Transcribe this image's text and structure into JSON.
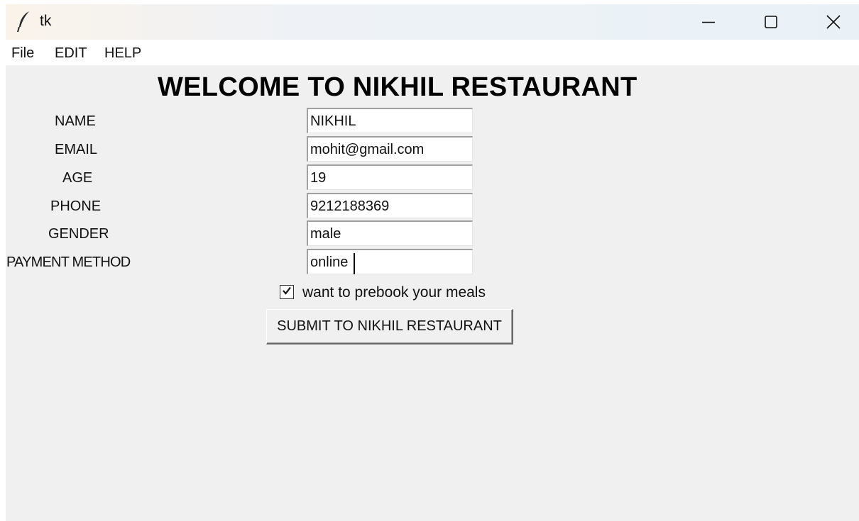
{
  "window": {
    "title": "tk"
  },
  "menu": {
    "file": "File",
    "edit": "EDIT",
    "help": "HELP"
  },
  "heading": "WELCOME TO NIKHIL RESTAURANT",
  "form": {
    "name_label": "NAME",
    "name_value": "NIKHIL",
    "email_label": "EMAIL",
    "email_value": "mohit@gmail.com",
    "age_label": "AGE",
    "age_value": "19",
    "phone_label": "PHONE",
    "phone_value": "9212188369",
    "gender_label": "GENDER",
    "gender_value": "male",
    "payment_label": "PAYMENT METHOD",
    "payment_value": "online",
    "prebook_label": "want to prebook your meals",
    "prebook_checked": true,
    "submit_label": "SUBMIT TO NIKHIL RESTAURANT"
  },
  "icons": {
    "app": "feather-icon",
    "minimize": "minimize-icon",
    "maximize": "maximize-icon",
    "close": "close-icon",
    "check": "checkmark-icon"
  }
}
